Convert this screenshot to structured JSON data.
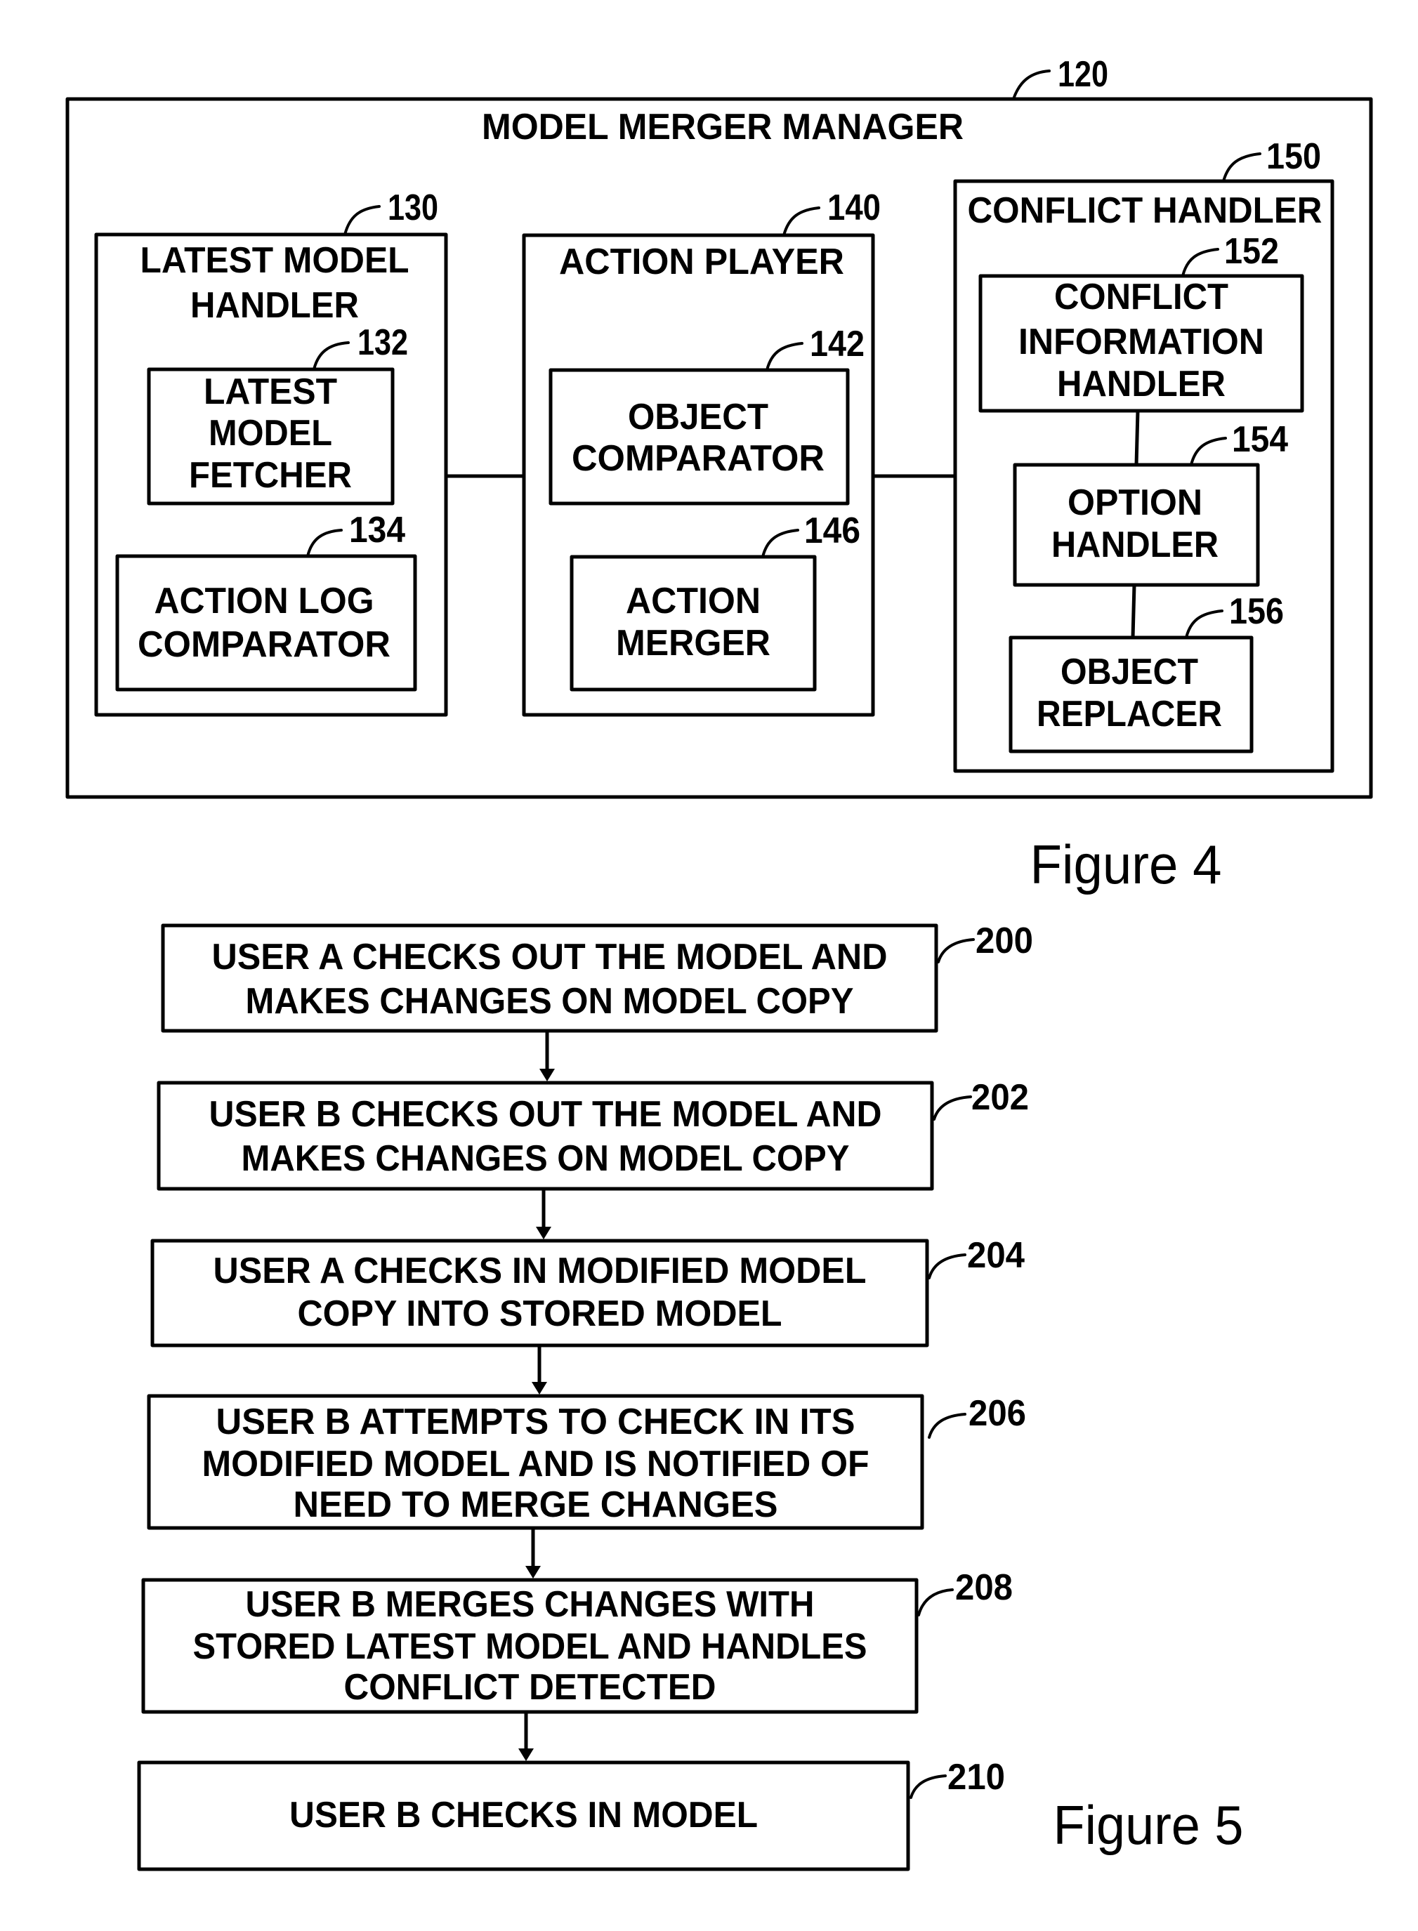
{
  "figure4": {
    "caption": "Figure 4",
    "manager": {
      "ref": "120",
      "title": "MODEL MERGER MANAGER"
    },
    "latest_model_handler": {
      "ref": "130",
      "title_lines": [
        "LATEST MODEL",
        "HANDLER"
      ],
      "fetcher": {
        "ref": "132",
        "lines": [
          "LATEST",
          "MODEL",
          "FETCHER"
        ]
      },
      "action_log_comparator": {
        "ref": "134",
        "lines": [
          "ACTION LOG",
          "COMPARATOR"
        ]
      }
    },
    "action_player": {
      "ref": "140",
      "title_lines": [
        "ACTION PLAYER"
      ],
      "object_comparator": {
        "ref": "142",
        "lines": [
          "OBJECT",
          "COMPARATOR"
        ]
      },
      "action_merger": {
        "ref": "146",
        "lines": [
          "ACTION",
          "MERGER"
        ]
      }
    },
    "conflict_handler": {
      "ref": "150",
      "title_lines": [
        "CONFLICT HANDLER"
      ],
      "conflict_information_handler": {
        "ref": "152",
        "lines": [
          "CONFLICT",
          "INFORMATION",
          "HANDLER"
        ]
      },
      "option_handler": {
        "ref": "154",
        "lines": [
          "OPTION",
          "HANDLER"
        ]
      },
      "object_replacer": {
        "ref": "156",
        "lines": [
          "OBJECT",
          "REPLACER"
        ]
      }
    }
  },
  "figure5": {
    "caption": "Figure 5",
    "steps": [
      {
        "ref": "200",
        "lines": [
          "USER A CHECKS OUT THE MODEL AND",
          "MAKES CHANGES ON MODEL COPY"
        ]
      },
      {
        "ref": "202",
        "lines": [
          "USER B CHECKS OUT THE MODEL AND",
          "MAKES CHANGES ON MODEL COPY"
        ]
      },
      {
        "ref": "204",
        "lines": [
          "USER A CHECKS IN MODIFIED MODEL",
          "COPY INTO STORED MODEL"
        ]
      },
      {
        "ref": "206",
        "lines": [
          "USER B ATTEMPTS TO CHECK IN ITS",
          "MODIFIED MODEL AND IS NOTIFIED OF",
          "NEED TO MERGE CHANGES"
        ]
      },
      {
        "ref": "208",
        "lines": [
          "USER B MERGES CHANGES WITH",
          "STORED LATEST MODEL AND HANDLES",
          "CONFLICT DETECTED"
        ]
      },
      {
        "ref": "210",
        "lines": [
          "USER B CHECKS IN MODEL"
        ]
      }
    ]
  }
}
